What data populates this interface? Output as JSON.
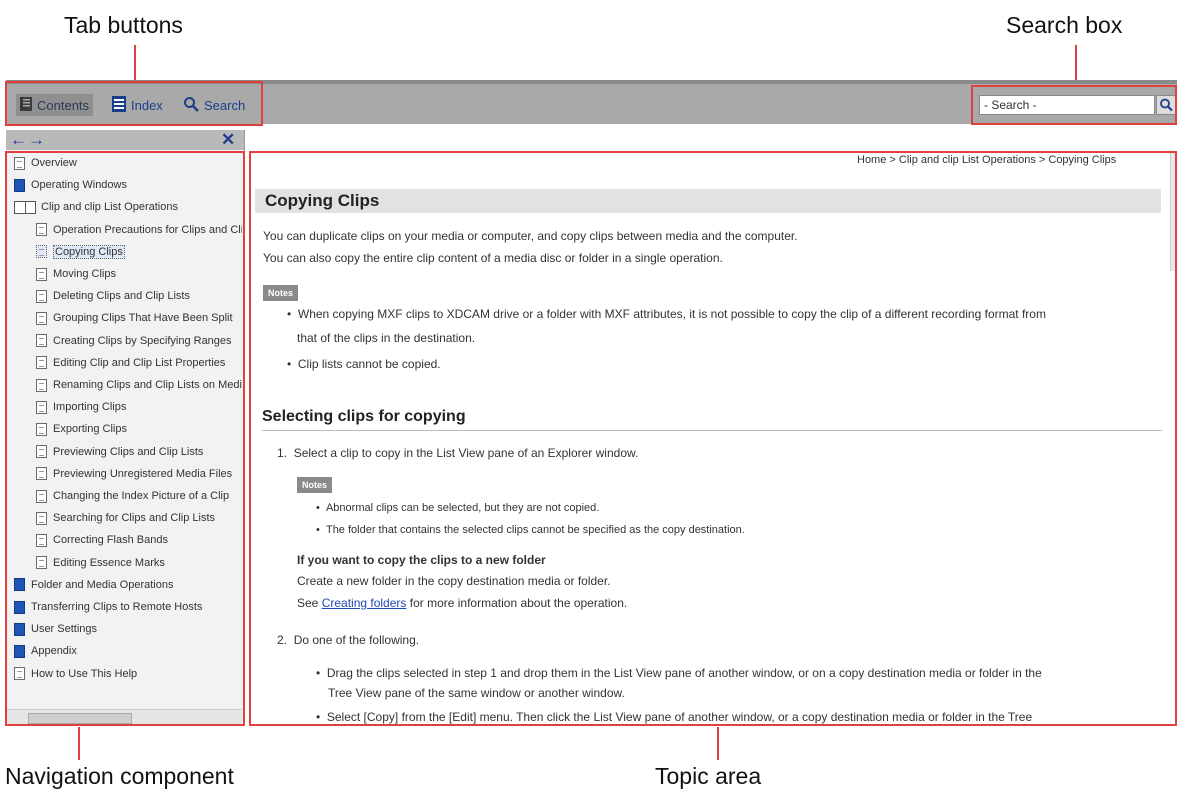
{
  "callouts": {
    "tab_buttons": "Tab buttons",
    "search_box": "Search box",
    "navigation": "Navigation component",
    "topic_area": "Topic area"
  },
  "toolbar": {
    "tabs": [
      {
        "label": "Contents",
        "icon": "contents-icon"
      },
      {
        "label": "Index",
        "icon": "index-icon"
      },
      {
        "label": "Search",
        "icon": "search-icon"
      }
    ],
    "search_placeholder": "- Search -"
  },
  "nav": {
    "back": "←",
    "forward": "→",
    "close": "✕",
    "items": [
      {
        "label": "Overview",
        "icon": "page-icon",
        "level": 0
      },
      {
        "label": "Operating Windows",
        "icon": "book-icon",
        "level": 0
      },
      {
        "label": "Clip and clip List Operations",
        "icon": "open-book-icon",
        "level": 0
      },
      {
        "label": "Operation Precautions for Clips and Clip Lists",
        "icon": "page-icon",
        "level": 1
      },
      {
        "label": "Copying Clips",
        "icon": "page-icon",
        "level": 1,
        "selected": true
      },
      {
        "label": "Moving Clips",
        "icon": "page-icon",
        "level": 1
      },
      {
        "label": "Deleting Clips and Clip Lists",
        "icon": "page-icon",
        "level": 1
      },
      {
        "label": "Grouping Clips That Have Been Split",
        "icon": "page-icon",
        "level": 1
      },
      {
        "label": "Creating Clips by Specifying Ranges",
        "icon": "page-icon",
        "level": 1
      },
      {
        "label": "Editing Clip and Clip List Properties",
        "icon": "page-icon",
        "level": 1
      },
      {
        "label": "Renaming Clips and Clip Lists on Media",
        "icon": "page-icon",
        "level": 1
      },
      {
        "label": "Importing Clips",
        "icon": "page-icon",
        "level": 1
      },
      {
        "label": "Exporting Clips",
        "icon": "page-icon",
        "level": 1
      },
      {
        "label": "Previewing Clips and Clip Lists",
        "icon": "page-icon",
        "level": 1
      },
      {
        "label": "Previewing Unregistered Media Files",
        "icon": "page-icon",
        "level": 1
      },
      {
        "label": "Changing the Index Picture of a Clip",
        "icon": "page-icon",
        "level": 1
      },
      {
        "label": "Searching for Clips and Clip Lists",
        "icon": "page-icon",
        "level": 1
      },
      {
        "label": "Correcting Flash Bands",
        "icon": "page-icon",
        "level": 1
      },
      {
        "label": "Editing Essence Marks",
        "icon": "page-icon",
        "level": 1
      },
      {
        "label": "Folder and Media Operations",
        "icon": "book-icon",
        "level": 0
      },
      {
        "label": "Transferring Clips to Remote Hosts",
        "icon": "book-icon",
        "level": 0
      },
      {
        "label": "User Settings",
        "icon": "book-icon",
        "level": 0
      },
      {
        "label": "Appendix",
        "icon": "book-icon",
        "level": 0
      },
      {
        "label": "How to Use This Help",
        "icon": "page-icon",
        "level": 0
      }
    ]
  },
  "topic": {
    "breadcrumb": "Home > Clip and clip List Operations > Copying Clips",
    "title": "Copying Clips",
    "intro1": "You can duplicate clips on your media or computer, and copy clips between media and the computer.",
    "intro2": "You can also copy the entire clip content of a media disc or folder in a single operation.",
    "notes_label": "Notes",
    "note1a": "When copying MXF clips to XDCAM drive or a folder with MXF attributes, it is not possible to copy the clip of a different recording format from",
    "note1b": "that of the clips in the destination.",
    "note2": "Clip lists cannot be copied.",
    "section_title": "Selecting clips for copying",
    "step1": "Select a clip to copy in the List View pane of an Explorer window.",
    "step1_note1": "Abnormal clips can be selected, but they are not copied.",
    "step1_note2": "The folder that contains the selected clips cannot be specified as the copy destination.",
    "new_folder_heading": "If you want to copy the clips to a new folder",
    "new_folder_text": "Create a new folder in the copy destination media or folder.",
    "see_prefix": "See ",
    "see_link": "Creating folders",
    "see_suffix": " for more information about the operation.",
    "step2": "Do one of the following.",
    "step2_b1a": "Drag the clips selected in step 1 and drop them in the List View pane of another window, or on a copy destination media or folder in the",
    "step2_b1b": "Tree View pane of the same window or another window.",
    "step2_b2": "Select [Copy] from the [Edit] menu. Then click the List View pane of another window, or a copy destination media or folder in the Tree"
  }
}
